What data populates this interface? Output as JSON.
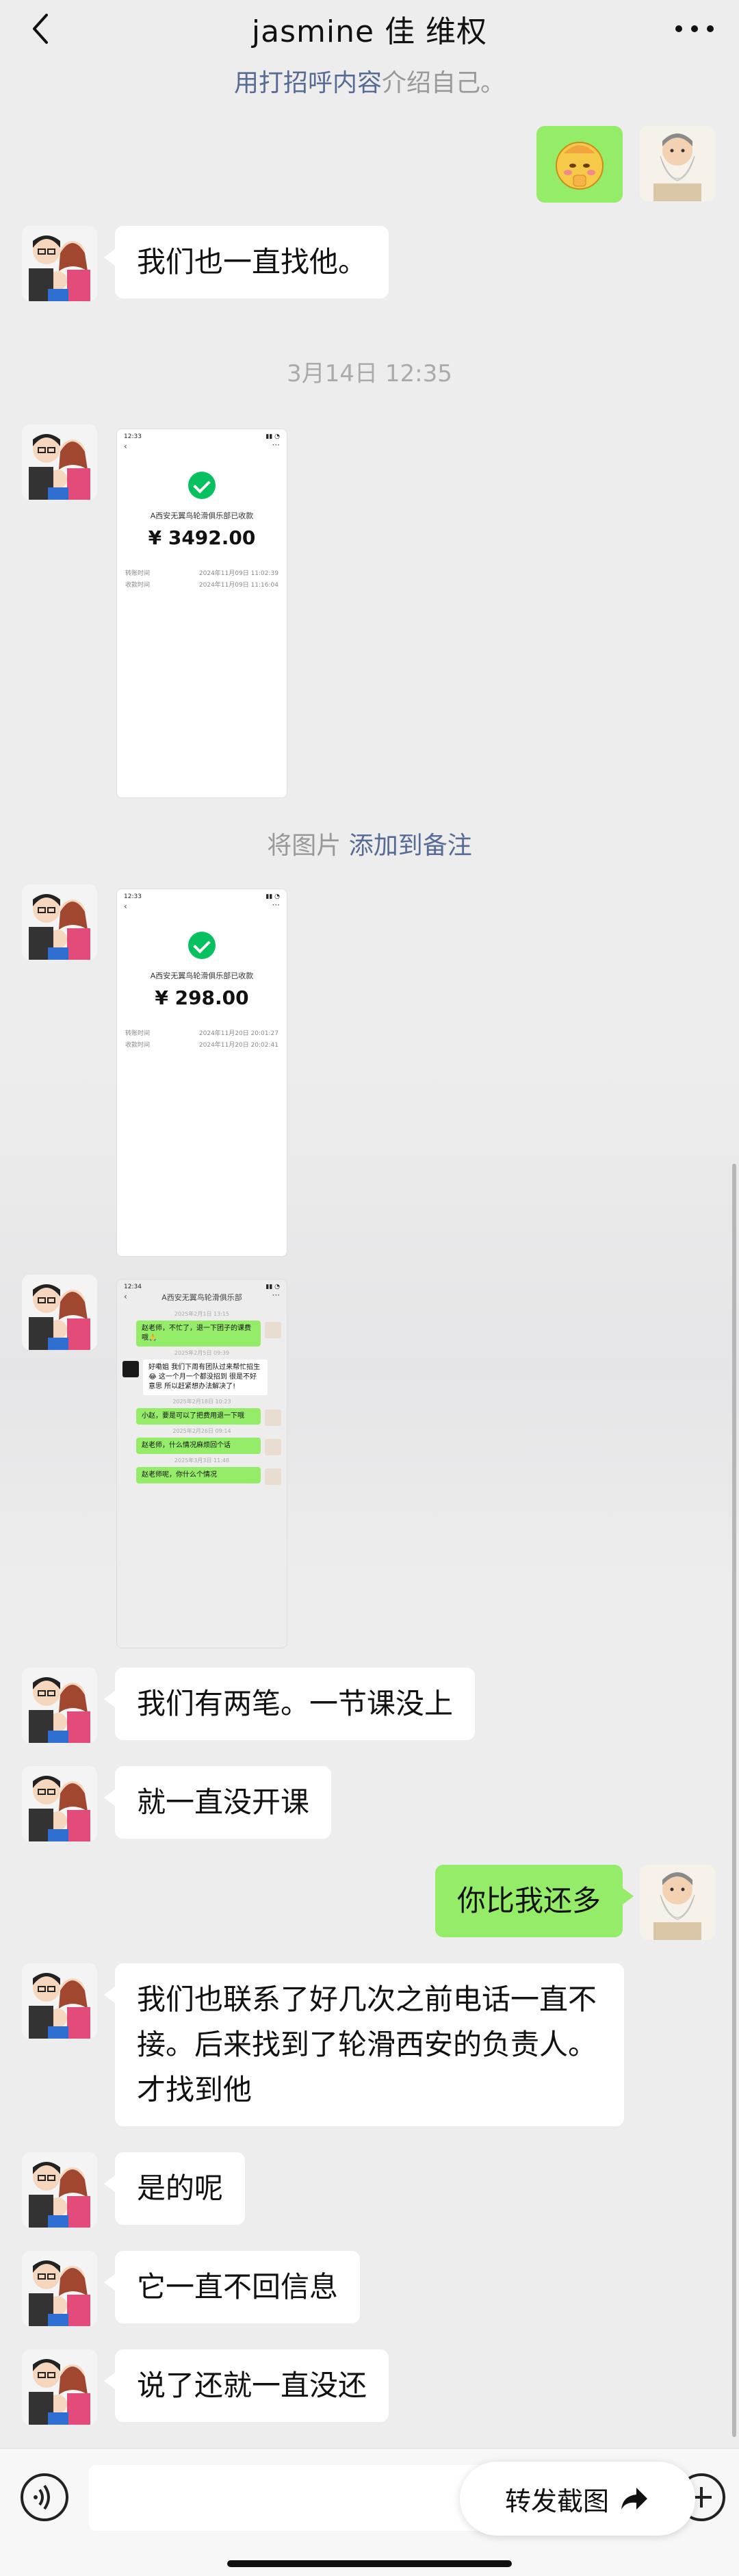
{
  "header": {
    "title": "jasmine 佳 维权"
  },
  "top_tip": {
    "pre": "用打招呼内容",
    "post": "介绍自己。"
  },
  "messages": {
    "m1": "我们也一直找他。",
    "ts1": "3月14日 12:35",
    "save_tip_pre": "将图片 ",
    "save_tip_link": "添加到备注",
    "m2": "我们有两笔。一节课没上",
    "m3": "就一直没开课",
    "m4": "你比我还多",
    "m5": "我们也联系了好几次之前电话一直不接。后来找到了轮滑西安的负责人。才找到他",
    "m6": "是的呢",
    "m7": "它一直不回信息",
    "m8": "说了还就一直没还"
  },
  "shot1": {
    "time": "12:33",
    "payee": "A西安无翼鸟轮滑俱乐部已收款",
    "amount": "¥ 3492.00",
    "rows": [
      {
        "k": "转账时间",
        "v": "2024年11月09日 11:02:39"
      },
      {
        "k": "收款时间",
        "v": "2024年11月09日 11:16:04"
      }
    ]
  },
  "shot2": {
    "time": "12:33",
    "payee": "A西安无翼鸟轮滑俱乐部已收款",
    "amount": "¥ 298.00",
    "rows": [
      {
        "k": "转账时间",
        "v": "2024年11月20日 20:01:27"
      },
      {
        "k": "收款时间",
        "v": "2024年11月20日 20:02:41"
      }
    ]
  },
  "shot3": {
    "time": "12:34",
    "title": "A西安无翼鸟轮滑俱乐部",
    "msgs": [
      {
        "t": "2025年2月1日 13:15"
      },
      {
        "side": "right",
        "text": "赵老师，不忙了，退一下团子的课费哦🙏"
      },
      {
        "t": "2025年2月5日 09:39"
      },
      {
        "side": "left",
        "text": "好嘞姐 我们下周有团队过来帮忙招生😂 这一个月一个都没招到 很是不好意思 所以赶紧想办法解决了!"
      },
      {
        "t": "2025年2月18日 10:23"
      },
      {
        "side": "right",
        "text": "小赵，要是可以了把费用退一下哦"
      },
      {
        "t": "2025年2月26日 09:14"
      },
      {
        "side": "right",
        "text": "赵老师，什么情况麻烦回个话"
      },
      {
        "t": "2025年3月3日 11:48"
      },
      {
        "side": "right",
        "text": "赵老师呢，你什么个情况"
      }
    ]
  },
  "forward": {
    "label": "转发截图"
  }
}
